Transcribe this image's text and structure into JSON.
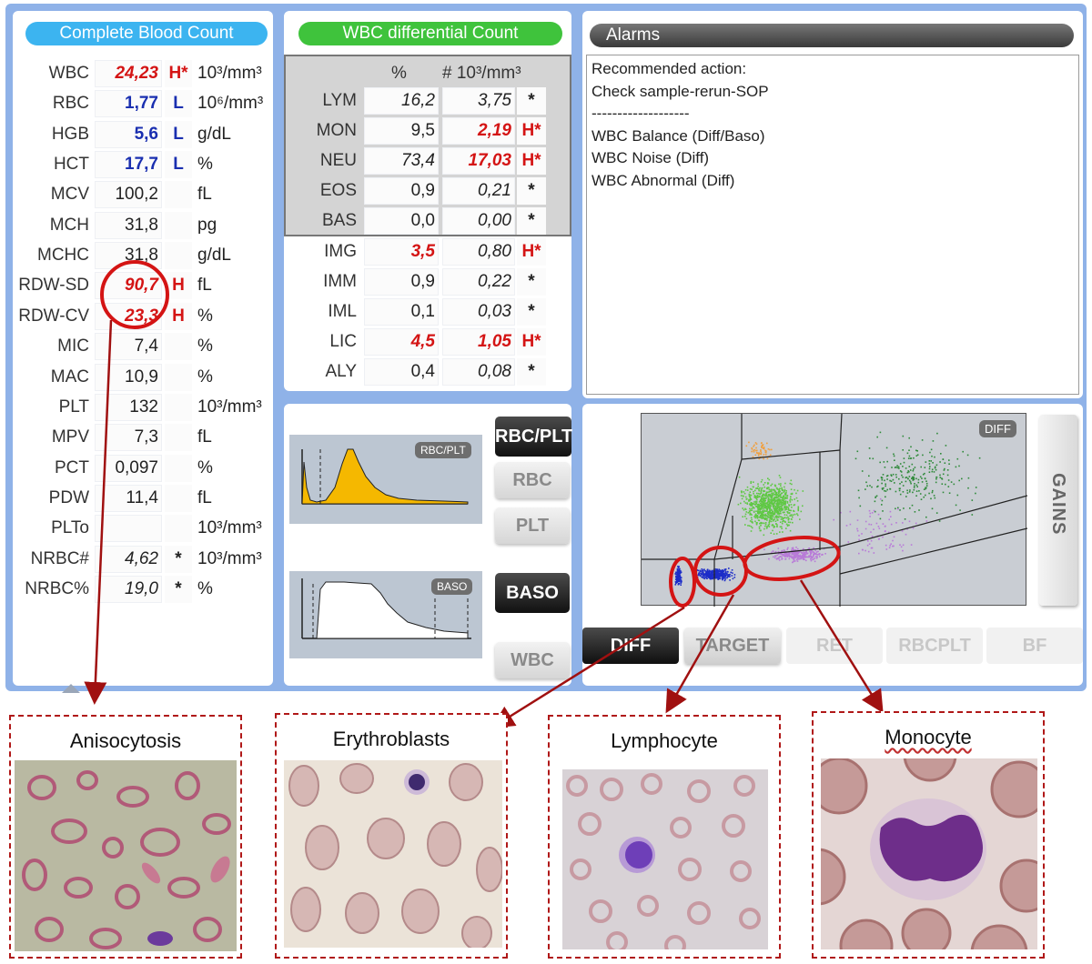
{
  "cbc": {
    "title": "Complete Blood Count",
    "rows": [
      {
        "param": "WBC",
        "value": "24,23",
        "flag": "H*",
        "unit": "10³/mm³",
        "style": "red"
      },
      {
        "param": "RBC",
        "value": "1,77",
        "flag": "L",
        "unit": "10⁶/mm³",
        "style": "blue"
      },
      {
        "param": "HGB",
        "value": "5,6",
        "flag": "L",
        "unit": "g/dL",
        "style": "blue"
      },
      {
        "param": "HCT",
        "value": "17,7",
        "flag": "L",
        "unit": "%",
        "style": "blue"
      },
      {
        "param": "MCV",
        "value": "100,2",
        "flag": "",
        "unit": "fL",
        "style": "plain"
      },
      {
        "param": "MCH",
        "value": "31,8",
        "flag": "",
        "unit": "pg",
        "style": "plain"
      },
      {
        "param": "MCHC",
        "value": "31,8",
        "flag": "",
        "unit": "g/dL",
        "style": "plain"
      },
      {
        "param": "RDW-SD",
        "value": "90,7",
        "flag": "H",
        "unit": "fL",
        "style": "red"
      },
      {
        "param": "RDW-CV",
        "value": "23,3",
        "flag": "H",
        "unit": "%",
        "style": "red"
      },
      {
        "param": "MIC",
        "value": "7,4",
        "flag": "",
        "unit": "%",
        "style": "plain"
      },
      {
        "param": "MAC",
        "value": "10,9",
        "flag": "",
        "unit": "%",
        "style": "plain"
      },
      {
        "param": "PLT",
        "value": "132",
        "flag": "",
        "unit": "10³/mm³",
        "style": "plain"
      },
      {
        "param": "MPV",
        "value": "7,3",
        "flag": "",
        "unit": "fL",
        "style": "plain"
      },
      {
        "param": "PCT",
        "value": "0,097",
        "flag": "",
        "unit": "%",
        "style": "plain"
      },
      {
        "param": "PDW",
        "value": "11,4",
        "flag": "",
        "unit": "fL",
        "style": "plain"
      },
      {
        "param": "PLTo",
        "value": "",
        "flag": "",
        "unit": "10³/mm³",
        "style": "plain"
      },
      {
        "param": "NRBC#",
        "value": "4,62",
        "flag": "*",
        "unit": "10³/mm³",
        "style": "ital"
      },
      {
        "param": "NRBC%",
        "value": "19,0",
        "flag": "*",
        "unit": "%",
        "style": "ital"
      }
    ]
  },
  "diff": {
    "title": "WBC differential Count",
    "col_pct": "%",
    "col_abs": "# 10³/mm³",
    "rows": [
      {
        "param": "LYM",
        "pct": "16,2",
        "abs": "3,75",
        "flag": "*",
        "pct_style": "ital",
        "abs_style": "ital"
      },
      {
        "param": "MON",
        "pct": "9,5",
        "abs": "2,19",
        "flag": "H*",
        "pct_style": "plain",
        "abs_style": "red"
      },
      {
        "param": "NEU",
        "pct": "73,4",
        "abs": "17,03",
        "flag": "H*",
        "pct_style": "ital",
        "abs_style": "red"
      },
      {
        "param": "EOS",
        "pct": "0,9",
        "abs": "0,21",
        "flag": "*",
        "pct_style": "plain",
        "abs_style": "ital"
      },
      {
        "param": "BAS",
        "pct": "0,0",
        "abs": "0,00",
        "flag": "*",
        "pct_style": "plain",
        "abs_style": "ital"
      },
      {
        "param": "IMG",
        "pct": "3,5",
        "abs": "0,80",
        "flag": "H*",
        "pct_style": "red",
        "abs_style": "ital"
      },
      {
        "param": "IMM",
        "pct": "0,9",
        "abs": "0,22",
        "flag": "*",
        "pct_style": "plain",
        "abs_style": "ital"
      },
      {
        "param": "IML",
        "pct": "0,1",
        "abs": "0,03",
        "flag": "*",
        "pct_style": "plain",
        "abs_style": "ital"
      },
      {
        "param": "LIC",
        "pct": "4,5",
        "abs": "1,05",
        "flag": "H*",
        "pct_style": "red",
        "abs_style": "red"
      },
      {
        "param": "ALY",
        "pct": "0,4",
        "abs": "0,08",
        "flag": "*",
        "pct_style": "plain",
        "abs_style": "ital"
      }
    ]
  },
  "alarms": {
    "title": "Alarms",
    "lines": [
      "Recommended action:",
      "Check sample-rerun-SOP",
      "-------------------",
      "WBC Balance (Diff/Baso)",
      "WBC Noise (Diff)",
      "WBC Abnormal (Diff)"
    ]
  },
  "histograms": {
    "rbcplt_tag": "RBC/PLT",
    "baso_tag": "BASO",
    "rbcplt_fill": "#f5b800",
    "baso_fill": "#ffffff"
  },
  "hist_buttons": [
    {
      "label": "RBC/PLT",
      "active": true
    },
    {
      "label": "RBC",
      "active": false
    },
    {
      "label": "PLT",
      "active": false
    },
    {
      "label": "BASO",
      "active": true
    },
    {
      "label": "WBC",
      "active": false
    }
  ],
  "scatter": {
    "tag": "DIFF",
    "gains_label": "GAINS",
    "colors": {
      "green": "#5fc844",
      "orange": "#f0a040",
      "purple": "#b87ad8",
      "blue": "#1c2cc8",
      "dark_green": "#2f8a3a"
    }
  },
  "scatter_tabs": [
    {
      "label": "DIFF",
      "active": true
    },
    {
      "label": "TARGET",
      "active": false
    },
    {
      "label": "RET",
      "active": false
    },
    {
      "label": "RBCPLT",
      "active": false
    },
    {
      "label": "BF",
      "active": false
    }
  ],
  "cell_images": [
    {
      "caption": "Anisocytosis"
    },
    {
      "caption": "Erythroblasts"
    },
    {
      "caption": "Lymphocyte"
    },
    {
      "caption": "Monocyte"
    }
  ],
  "accents": {
    "highlight_red": "#d41414",
    "low_blue": "#1a2fb0",
    "arrow": "#a01010"
  }
}
